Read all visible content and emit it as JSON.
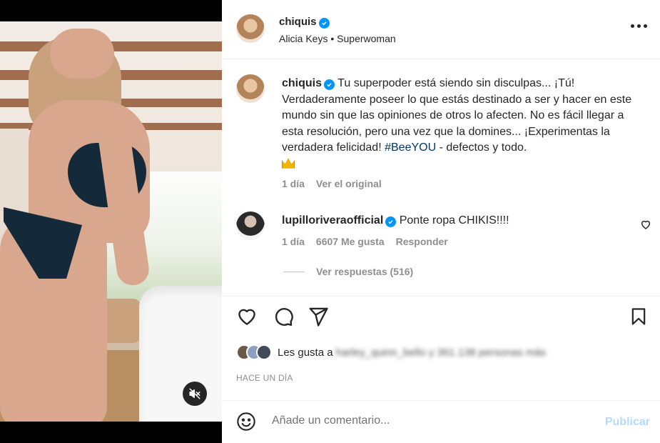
{
  "header": {
    "username": "chiquis",
    "audio_artist": "Alicia Keys",
    "audio_separator": "•",
    "audio_track": "Superwoman",
    "more_icon": "more-horizontal-icon"
  },
  "caption": {
    "username": "chiquis",
    "text": "Tu superpoder está siendo sin disculpas... ¡Tú! Verdaderamente poseer lo que estás destinado a ser y hacer en este mundo sin que las opiniones de otros lo afecten. No es fácil llegar a esta resolución, pero una vez que la domines... ¡Experimentas la verdadera felicidad! ",
    "hashtag": "#BeeYOU",
    "text_end": " - defectos y todo.",
    "emoji": "crown-icon",
    "time": "1 día",
    "see_original": "Ver el original"
  },
  "comment": {
    "username": "lupilloriveraofficial",
    "text": "Ponte ropa CHIKIS!!!!",
    "time": "1 día",
    "likes": "6607 Me gusta",
    "reply": "Responder",
    "view_replies": "Ver respuestas (516)"
  },
  "likes": {
    "prefix": "Les gusta a",
    "blurred": "harley_quinn_bello y 361.138 personas más"
  },
  "post_time": "HACE UN DÍA",
  "add_comment": {
    "placeholder": "Añade un comentario...",
    "publish": "Publicar"
  },
  "colors": {
    "verified": "#0095f6",
    "hashtag": "#00376b",
    "publish_disabled": "#b3dbff",
    "muted_text": "#8e8e8e"
  }
}
